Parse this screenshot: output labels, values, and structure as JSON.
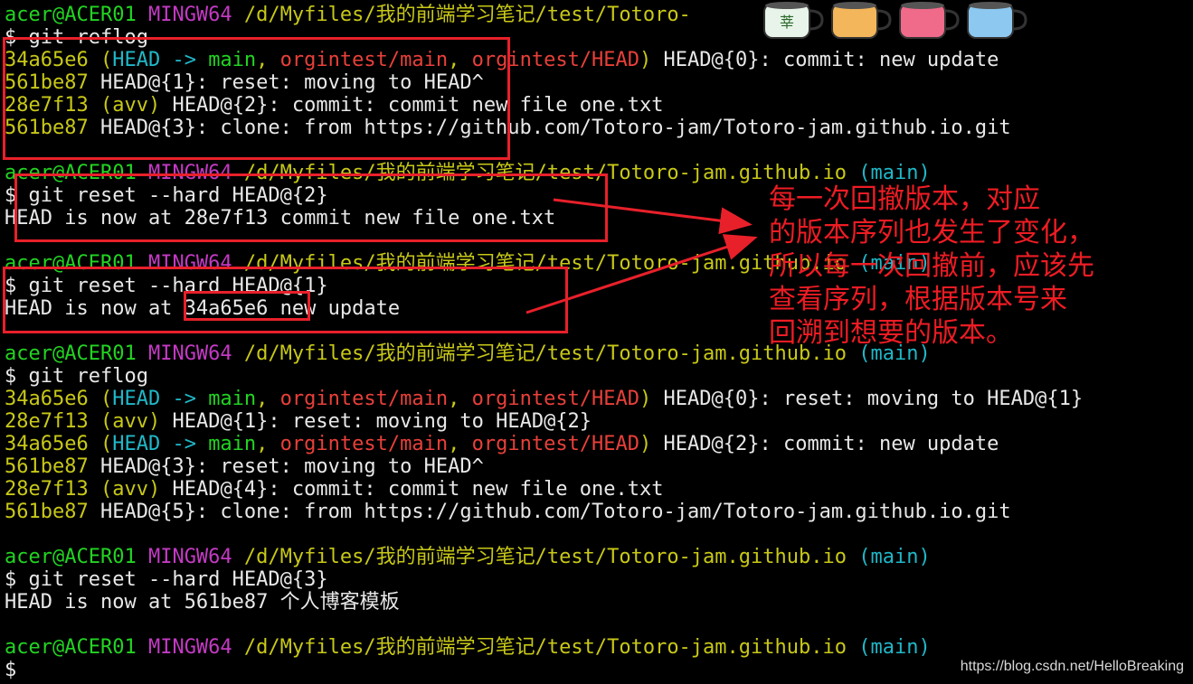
{
  "terminal": {
    "blocks": [
      {
        "kind": "prompt",
        "user": "acer@ACER01",
        "env": "MINGW64",
        "path": "/d/Myfiles/我的前端学习笔记/test/Totoro-",
        "branch": ""
      },
      {
        "kind": "cmd",
        "text": "$ git reflog"
      },
      {
        "kind": "reflog",
        "hash": "34a65e6",
        "refs": true,
        "head": "HEAD",
        "arrow": " -> ",
        "main": "main",
        "sep1": ", ",
        "r1": "orgintest/main",
        "sep2": ", ",
        "r2": "orgintest/HEAD",
        "rest": " HEAD@{0}: commit: new update"
      },
      {
        "kind": "reflog",
        "hash": "561be87",
        "rest": " HEAD@{1}: reset: moving to HEAD^"
      },
      {
        "kind": "reflog",
        "hash": "28e7f13",
        "avv": "avv",
        "rest": " HEAD@{2}: commit: commit new file one.txt"
      },
      {
        "kind": "reflog",
        "hash": "561be87",
        "rest": " HEAD@{3}: clone: from https://github.com/Totoro-jam/Totoro-jam.github.io.git"
      },
      {
        "kind": "blank"
      },
      {
        "kind": "prompt",
        "user": "acer@ACER01",
        "env": "MINGW64",
        "path": "/d/Myfiles/我的前端学习笔记/test/Totoro-jam.github.io",
        "branch": "(main)"
      },
      {
        "kind": "cmd",
        "text": "$ git reset --hard HEAD@{2}"
      },
      {
        "kind": "out",
        "text": "HEAD is now at 28e7f13 commit new file one.txt"
      },
      {
        "kind": "blank"
      },
      {
        "kind": "prompt",
        "user": "acer@ACER01",
        "env": "MINGW64",
        "path": "/d/Myfiles/我的前端学习笔记/test/Totoro-jam.github.io",
        "branch": "(main)"
      },
      {
        "kind": "cmd",
        "text": "$ git reset --hard HEAD@{1}"
      },
      {
        "kind": "out",
        "text": "HEAD is now at 34a65e6 new update"
      },
      {
        "kind": "blank"
      },
      {
        "kind": "prompt",
        "user": "acer@ACER01",
        "env": "MINGW64",
        "path": "/d/Myfiles/我的前端学习笔记/test/Totoro-jam.github.io",
        "branch": "(main)"
      },
      {
        "kind": "cmd",
        "text": "$ git reflog"
      },
      {
        "kind": "reflog",
        "hash": "34a65e6",
        "refs": true,
        "head": "HEAD",
        "arrow": " -> ",
        "main": "main",
        "sep1": ", ",
        "r1": "orgintest/main",
        "sep2": ", ",
        "r2": "orgintest/HEAD",
        "rest": " HEAD@{0}: reset: moving to HEAD@{1}"
      },
      {
        "kind": "reflog",
        "hash": "28e7f13",
        "avv": "avv",
        "rest": " HEAD@{1}: reset: moving to HEAD@{2}"
      },
      {
        "kind": "reflog",
        "hash": "34a65e6",
        "refs": true,
        "head": "HEAD",
        "arrow": " -> ",
        "main": "main",
        "sep1": ", ",
        "r1": "orgintest/main",
        "sep2": ", ",
        "r2": "orgintest/HEAD",
        "rest": " HEAD@{2}: commit: new update"
      },
      {
        "kind": "reflog",
        "hash": "561be87",
        "rest": " HEAD@{3}: reset: moving to HEAD^"
      },
      {
        "kind": "reflog",
        "hash": "28e7f13",
        "avv": "avv",
        "rest": " HEAD@{4}: commit: commit new file one.txt"
      },
      {
        "kind": "reflog",
        "hash": "561be87",
        "rest": " HEAD@{5}: clone: from https://github.com/Totoro-jam/Totoro-jam.github.io.git"
      },
      {
        "kind": "blank"
      },
      {
        "kind": "prompt",
        "user": "acer@ACER01",
        "env": "MINGW64",
        "path": "/d/Myfiles/我的前端学习笔记/test/Totoro-jam.github.io",
        "branch": "(main)"
      },
      {
        "kind": "cmd",
        "text": "$ git reset --hard HEAD@{3}"
      },
      {
        "kind": "out",
        "text": "HEAD is now at 561be87 个人博客模板"
      },
      {
        "kind": "blank"
      },
      {
        "kind": "prompt",
        "user": "acer@ACER01",
        "env": "MINGW64",
        "path": "/d/Myfiles/我的前端学习笔记/test/Totoro-jam.github.io",
        "branch": "(main)"
      },
      {
        "kind": "cmd",
        "text": "$"
      }
    ]
  },
  "annotation": {
    "note": "每一次回撤版本，对应\n的版本序列也发生了变化，\n所以每一次回撤前，应该先\n查看序列，根据版本号来\n回溯到想要的版本。"
  },
  "decor": {
    "cups": [
      {
        "color": "#e8f4ea",
        "label": "莘"
      },
      {
        "color": "#f4b65a",
        "label": ""
      },
      {
        "color": "#f06a8a",
        "label": ""
      },
      {
        "color": "#8cc8f0",
        "label": ""
      }
    ]
  },
  "watermark": "https://blog.csdn.net/HelloBreaking"
}
